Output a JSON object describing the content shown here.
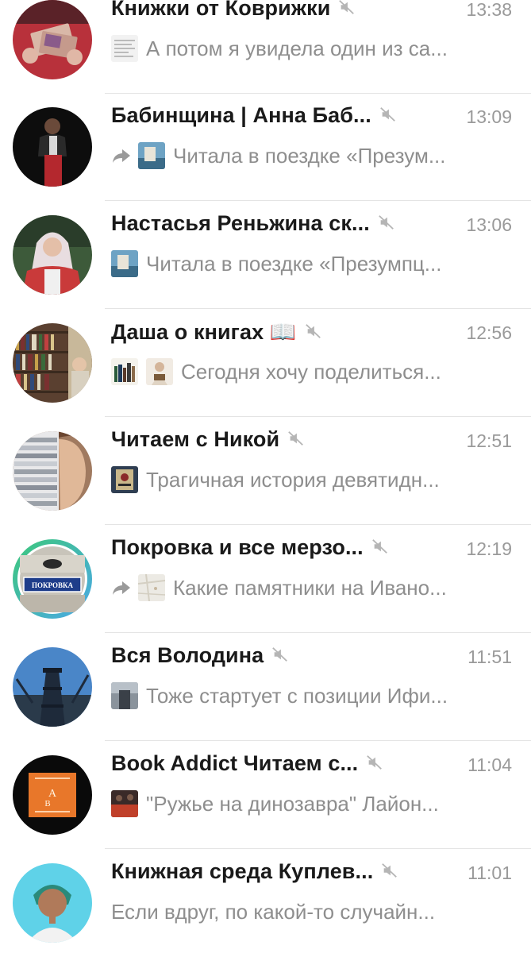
{
  "chats": [
    {
      "title": "Книжки от Коврижки",
      "time": "13:38",
      "preview": "А потом я увидела один из са...",
      "muted": true,
      "forwarded": false,
      "avatar_icon": "money-photo",
      "thumbs": [
        "document-thumb"
      ]
    },
    {
      "title": "Бабинщина | Анна Баб...",
      "time": "13:09",
      "preview": "Читала в поездке «Презум...",
      "muted": true,
      "forwarded": true,
      "avatar_icon": "person-photo",
      "thumbs": [
        "book-thumb"
      ]
    },
    {
      "title": "Настасья Реньжина ск...",
      "time": "13:06",
      "preview": "Читала в поездке «Презумпц...",
      "muted": true,
      "forwarded": false,
      "avatar_icon": "woman-headscarf-photo",
      "thumbs": [
        "book-thumb"
      ]
    },
    {
      "title": "Даша о книгах 📖",
      "time": "12:56",
      "preview": "Сегодня хочу поделиться...",
      "muted": true,
      "forwarded": false,
      "avatar_icon": "bookshelf-photo",
      "thumbs": [
        "books-thumb",
        "girl-books-thumb"
      ]
    },
    {
      "title": "Читаем с Никой",
      "time": "12:51",
      "preview": "Трагичная история девятидн...",
      "muted": true,
      "forwarded": false,
      "avatar_icon": "girl-books-photo",
      "thumbs": [
        "cover-thumb"
      ]
    },
    {
      "title": "Покровка и все мерзо...",
      "time": "12:19",
      "preview": "Какие памятники на Ивано...",
      "muted": true,
      "forwarded": true,
      "avatar_icon": "street-sign-photo",
      "avatar_label": "ПОКРОВКА",
      "thumbs": [
        "map-thumb"
      ]
    },
    {
      "title": "Вся Володина",
      "time": "11:51",
      "preview": "Тоже стартует с позиции Ифи...",
      "muted": true,
      "forwarded": false,
      "avatar_icon": "tower-photo",
      "thumbs": [
        "photo-thumb"
      ]
    },
    {
      "title": "Book Addict Читаем с...",
      "time": "11:04",
      "preview": "\"Ружье на динозавра\" Лайон...",
      "muted": true,
      "forwarded": false,
      "avatar_icon": "book-addict-logo",
      "thumbs": [
        "cover-thumb-dark"
      ]
    },
    {
      "title": "Книжная среда Куплев...",
      "time": "11:01",
      "preview": "Если вдруг, по какой-то случайн...",
      "muted": true,
      "forwarded": false,
      "avatar_icon": "woman-portrait-photo",
      "thumbs": []
    }
  ],
  "colors": {
    "title": "#1a1a1a",
    "muted_text": "#8e8e8e",
    "time": "#9a9a9a",
    "divider": "#e4e4e4",
    "story_ring_green": "#3dc87a",
    "story_ring_blue": "#4aa8e8"
  }
}
